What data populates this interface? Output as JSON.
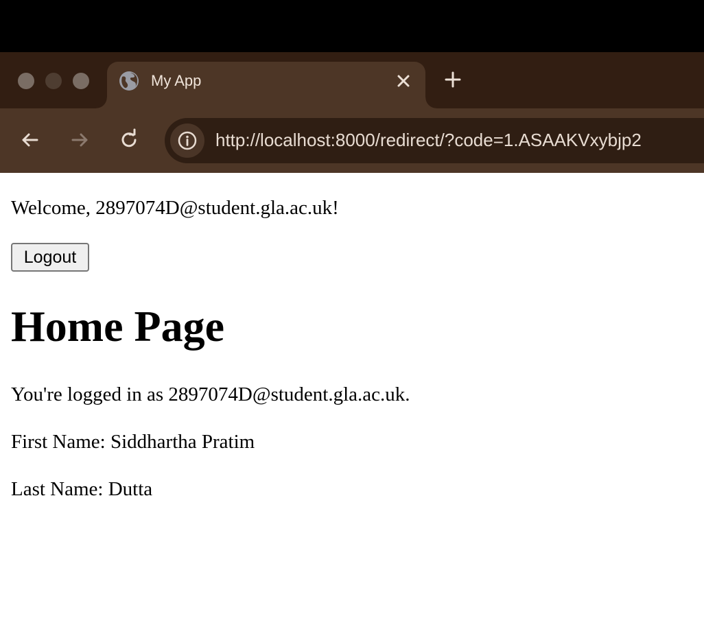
{
  "browser": {
    "tab": {
      "title": "My App",
      "icon": "globe-icon",
      "close_icon": "close-icon"
    },
    "new_tab_icon": "plus-icon",
    "nav": {
      "back_icon": "back-arrow-icon",
      "forward_icon": "forward-arrow-icon",
      "reload_icon": "reload-icon"
    },
    "address_bar": {
      "site_info_icon": "info-icon",
      "url": "http://localhost:8000/redirect/?code=1.ASAAKVxybjp2"
    },
    "colors": {
      "tab_strip": "#321e12",
      "active_tab": "#4d3626",
      "omnibox": "#2f1e13"
    }
  },
  "page": {
    "welcome_text": "Welcome, 2897074D@student.gla.ac.uk!",
    "logout_label": "Logout",
    "heading": "Home Page",
    "logged_in_text": "You're logged in as 2897074D@student.gla.ac.uk.",
    "first_name_text": "First Name: Siddhartha Pratim",
    "last_name_text": "Last Name: Dutta"
  }
}
